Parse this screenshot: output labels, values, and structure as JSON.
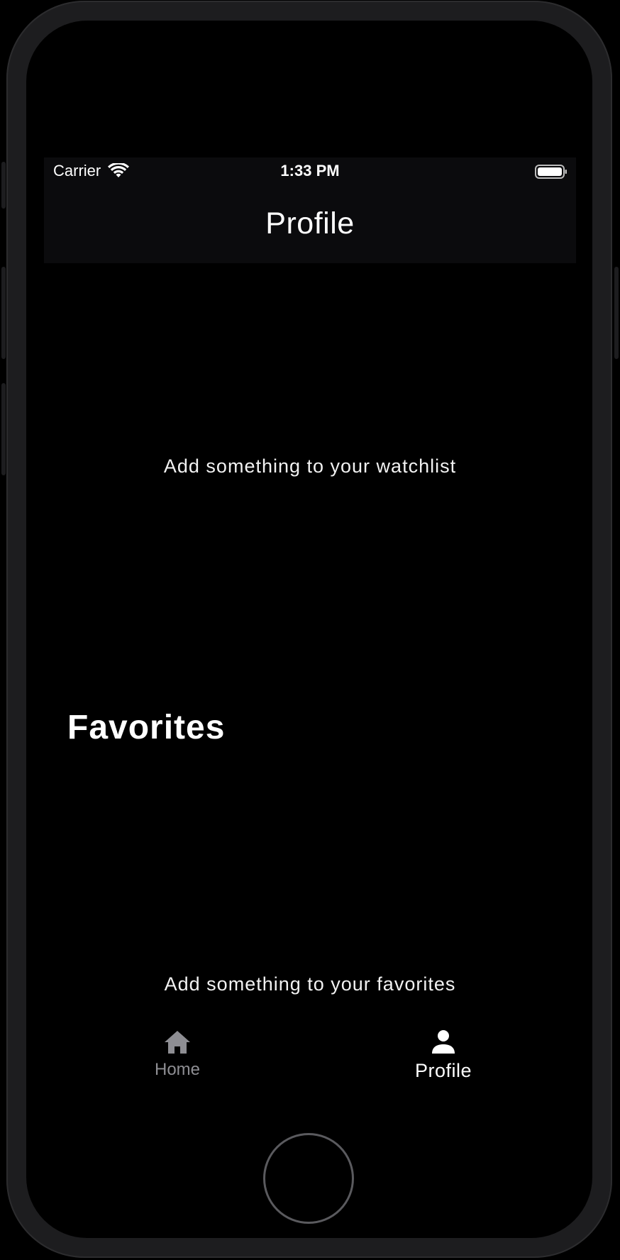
{
  "status_bar": {
    "carrier": "Carrier",
    "time": "1:33 PM",
    "wifi_icon": "wifi-icon",
    "battery_icon": "battery-icon"
  },
  "nav": {
    "title": "Profile"
  },
  "watchlist": {
    "empty_message": "Add something to your watchlist"
  },
  "favorites": {
    "title": "Favorites",
    "empty_message": "Add something to your favorites"
  },
  "tab_bar": {
    "tabs": [
      {
        "label": "Home",
        "icon": "house-icon",
        "selected": false
      },
      {
        "label": "Profile",
        "icon": "person-icon",
        "selected": true
      }
    ]
  },
  "colors": {
    "background": "#000000",
    "nav_background": "#0b0b0d",
    "text": "#ffffff",
    "inactive_tab": "#8e8e93",
    "device_frame": "#1d1d1f"
  }
}
